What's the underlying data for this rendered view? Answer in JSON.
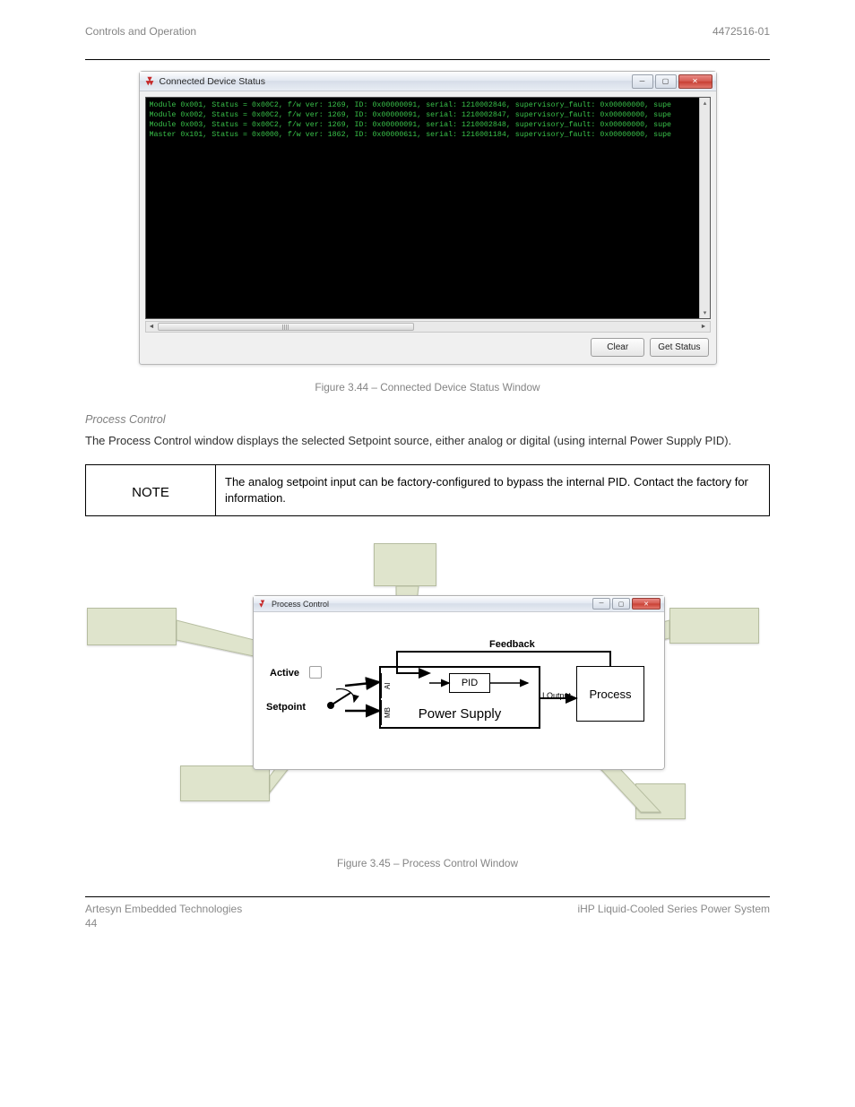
{
  "header": {
    "left": "Controls and Operation",
    "right": "4472516-01"
  },
  "figure1": {
    "window_title": "Connected Device Status",
    "minimize_label": "─",
    "maximize_label": "▢",
    "close_label": "✕",
    "terminal_lines": [
      "Module 0x001, Status = 0x00C2, f/w ver: 1269, ID: 0x00000091, serial: 1210002846, supervisory_fault: 0x00000000, supe",
      "Module 0x002, Status = 0x00C2, f/w ver: 1269, ID: 0x00000091, serial: 1210002847, supervisory_fault: 0x00000000, supe",
      "Module 0x003, Status = 0x00C2, f/w ver: 1269, ID: 0x00000091, serial: 1210002848, supervisory_fault: 0x00000000, supe",
      "Master 0x101, Status = 0x0000, f/w ver: 1862, ID: 0x00000611, serial: 1216001184, supervisory_fault: 0x00000000, supe"
    ],
    "scroll_left": "◄",
    "scroll_right": "►",
    "scroll_up": "▴",
    "scroll_down": "▾",
    "clear_btn": "Clear",
    "getstatus_btn": "Get Status",
    "caption": "Figure 3.44 – Connected Device Status Window"
  },
  "section": {
    "heading": "Process Control",
    "body": "The Process Control window displays the selected Setpoint source, either analog or digital (using internal Power Supply PID)."
  },
  "table": {
    "left": "NOTE",
    "right": "The analog setpoint input can be factory-configured to bypass the internal PID. Contact the factory for information."
  },
  "figure2": {
    "window_title": "Process Control",
    "minimize_label": "─",
    "maximize_label": "▢",
    "close_label": "✕",
    "active_label": "Active",
    "setpoint_label": "Setpoint",
    "feedback_label": "Feedback",
    "pid_label": "PID",
    "ai_label": "AI",
    "mb_label": "MB",
    "powersupply_label": "Power Supply",
    "ioutput_label": "I Output",
    "process_label": "Process",
    "caption": "Figure 3.45 – Process Control Window"
  },
  "footer": {
    "line1_left": "Artesyn Embedded Technologies",
    "line1_right": "iHP Liquid-Cooled Series Power System",
    "line2": "44"
  }
}
